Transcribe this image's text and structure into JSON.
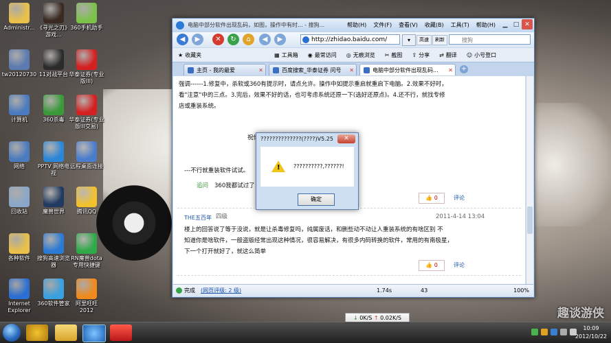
{
  "desktop_icons": [
    {
      "label": "Administr...",
      "color": "#e8c04a"
    },
    {
      "label": "《寻光之刃》游戏...",
      "color": "#3a2a22"
    },
    {
      "label": "360手机助手",
      "color": "#7cc24a"
    },
    {
      "label": "tw20120730",
      "color": "#5a7ab0"
    },
    {
      "label": "11对战平台",
      "color": "#2b2b2b"
    },
    {
      "label": "华泰证券(专业版III)",
      "color": "#d42020"
    },
    {
      "label": "计算机",
      "color": "#4b7bbf"
    },
    {
      "label": "360杀毒",
      "color": "#3a9a3a"
    },
    {
      "label": "华泰证券(专业版III交易)",
      "color": "#d42020"
    },
    {
      "label": "网络",
      "color": "#4b7bbf"
    },
    {
      "label": "PPTV 网络电视",
      "color": "#2b86d8"
    },
    {
      "label": "远程桌面连接",
      "color": "#4a7ccc"
    },
    {
      "label": "回收站",
      "color": "#8aa7c9"
    },
    {
      "label": "魔兽世界",
      "color": "#203a60"
    },
    {
      "label": "腾讯QQ",
      "color": "#f2c12e"
    },
    {
      "label": "各种软件",
      "color": "#e8c04a"
    },
    {
      "label": "搜狗高速浏览器",
      "color": "#2a7bd6"
    },
    {
      "label": "RN魔兽dota专用快捷键",
      "color": "#2eaa48"
    },
    {
      "label": "Internet Explorer",
      "color": "#2a6fd1"
    },
    {
      "label": "360软件管家",
      "color": "#3aa0e0"
    },
    {
      "label": "阿里旺旺2012",
      "color": "#f08a1c"
    }
  ],
  "browser": {
    "title": "电脑中部分软件出现乱码，如图，操作中有时... - 搜狗...",
    "menu": [
      "帮助(H)",
      "文件(F)",
      "查看(V)",
      "收藏(B)",
      "工具(T)",
      "帮助(H)"
    ],
    "address": "http://zhidao.baidu.com/",
    "search_engine": "百度",
    "search_placeholder": "搜狗",
    "pills": [
      "高速",
      "刷新"
    ],
    "favbar": [
      "收藏夹",
      "工具箱",
      "最常访问",
      "无痕浏览",
      "截图",
      "分享",
      "翻译",
      "小号登口"
    ],
    "tabs": [
      {
        "label": "主页 - 我的最爱",
        "active": false
      },
      {
        "label": "百度搜索_华泰证券 问号",
        "active": false
      },
      {
        "label": "电脑中部分软件出现乱码...",
        "active": true
      }
    ],
    "content": {
      "para1": "强调------1.修复中，杀软或360有提示时，请点允许。操作中如提示重启就重启下电脑。2.效果不好时，",
      "para1b": "看\"注意\"中的三点。3.完后，效果不好的话，也可考虑系统还原一下(选好还原点)。4.还不行，就找专修",
      "para1c": "店或重装系统。",
      "wish": "祝你",
      "note": "---不行就重装软件试试。",
      "reply_tag": "追问",
      "reply_text": "360我都试过了，",
      "vote1": "0",
      "comment1": "评论",
      "date2": "2011-4-14 13:04",
      "user2": "THE五百年",
      "level2": "四级",
      "para2": "楼上的回答说了等于没说，就是让杀毒修复吗，纯属废话，和删些动不动让人重装系统的有啥区别 不",
      "para2b": "知道你是啥软件，一般盗版经常出现这种情况，很容易解决，有很多内码转换的软件，常用的有南极星，",
      "para2c": "下一个打开就好了，就这么简单",
      "vote2": "0",
      "comment2": "评论"
    },
    "status": {
      "left": "完成",
      "rating": "(网页评级: 2 级)",
      "speed": "1.74s",
      "count": "43",
      "zoom": "100%"
    }
  },
  "dialog": {
    "title": "??????????????(????)V5.25",
    "close": "✕",
    "message": "??????????,??????!",
    "ok": "确定"
  },
  "download_bar": {
    "down": "0K/S",
    "up": "0.02K/S"
  },
  "taskbar": {
    "time": "10:09",
    "date": "2012/10/22"
  },
  "watermark": "趣谈游侠"
}
